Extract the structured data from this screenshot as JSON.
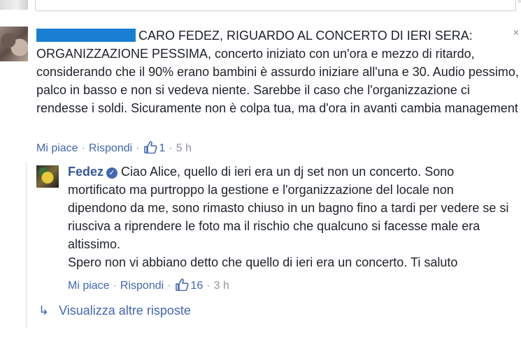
{
  "comment1": {
    "text": "CARO FEDEZ, RIGUARDO AL CONCERTO DI IERI SERA: ORGANIZZAZIONE PESSIMA, concerto iniziato con un'ora e mezzo di ritardo, considerando che il 90% erano bambini è assurdo iniziare all'una e 30. Audio pessimo, palco in basso e non si vedeva niente. Sarebbe il caso che l'organizzazione ci rendesse i soldi. Sicuramente non è colpa tua, ma d'ora in avanti cambia management",
    "like_label": "Mi piace",
    "reply_label": "Rispondi",
    "likes": "1",
    "time": "5 h"
  },
  "reply": {
    "author": "Fedez",
    "text": "Ciao Alice, quello di ieri era un dj set non un concerto. Sono mortificato ma purtroppo la gestione e l'organizzazione del locale non dipendono da me, sono rimasto chiuso in un bagno fino a tardi per vedere se si riusciva a riprendere le foto ma il rischio che qualcuno si facesse male era altissimo.",
    "text2": "Spero non vi abbiano detto che quello di ieri era un concerto. Ti saluto",
    "like_label": "Mi piace",
    "reply_label": "Rispondi",
    "likes": "16",
    "time": "3 h"
  },
  "more_replies": "Visualizza altre risposte",
  "colors": {
    "link": "#4267b2",
    "author": "#365899",
    "meta": "#90949c",
    "redaction": "#1a7fd1"
  },
  "icons": [
    "close-icon",
    "like-icon",
    "verified-icon",
    "reply-arrow-icon"
  ]
}
